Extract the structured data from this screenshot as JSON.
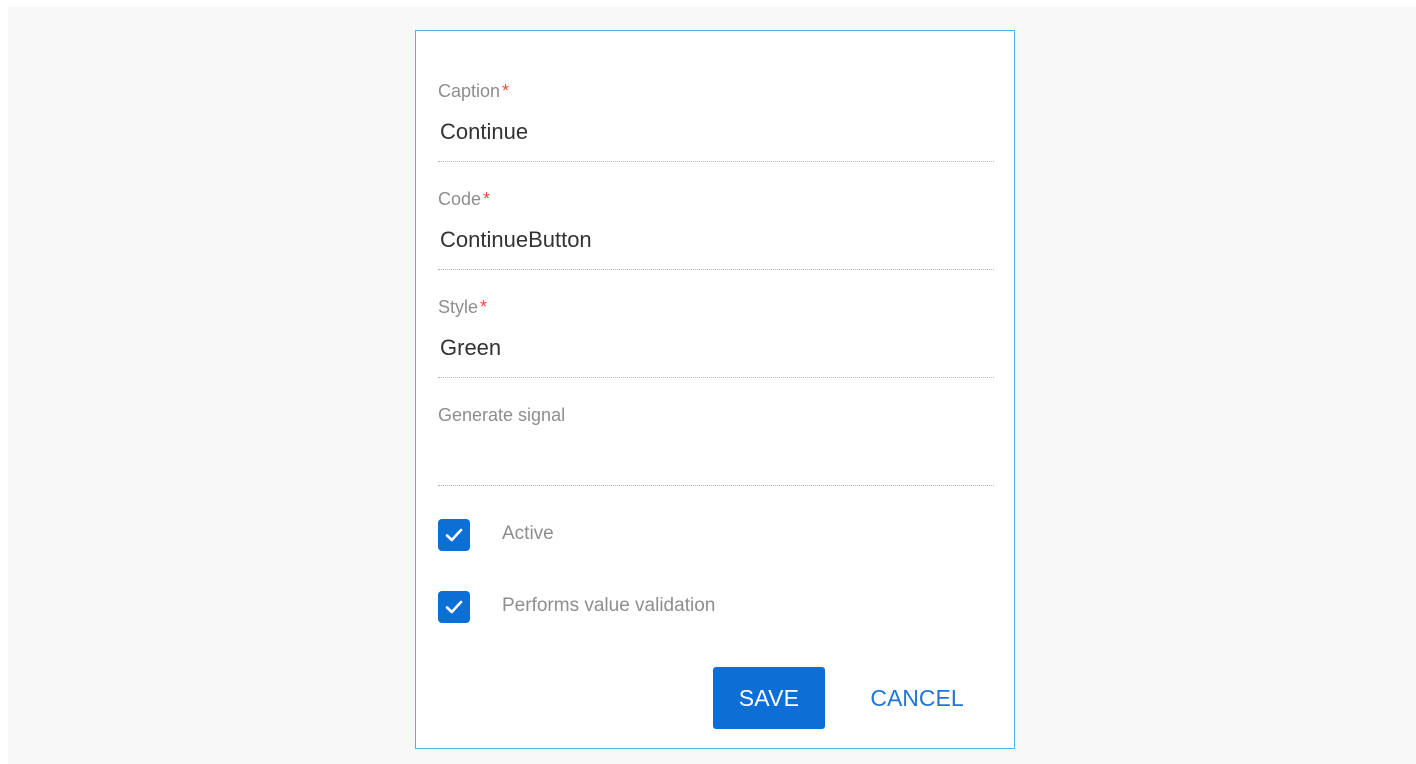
{
  "form": {
    "fields": [
      {
        "label": "Caption",
        "required_mark": "*",
        "value": "Continue"
      },
      {
        "label": "Code",
        "required_mark": "*",
        "value": "ContinueButton"
      },
      {
        "label": "Style",
        "required_mark": "*",
        "value": "Green"
      },
      {
        "label": "Generate signal",
        "value": ""
      }
    ],
    "checkboxes": [
      {
        "label": "Active",
        "checked": true,
        "icon": "checkmark-icon"
      },
      {
        "label": "Performs value validation",
        "checked": true,
        "icon": "checkmark-icon"
      }
    ],
    "buttons": {
      "save_label": "SAVE",
      "cancel_label": "CANCEL"
    }
  },
  "colors": {
    "accent": "#0b6fd6",
    "dialog_border": "#4bb4e6",
    "required": "#f0483e",
    "label": "#8e8e8e",
    "value": "#333333"
  }
}
